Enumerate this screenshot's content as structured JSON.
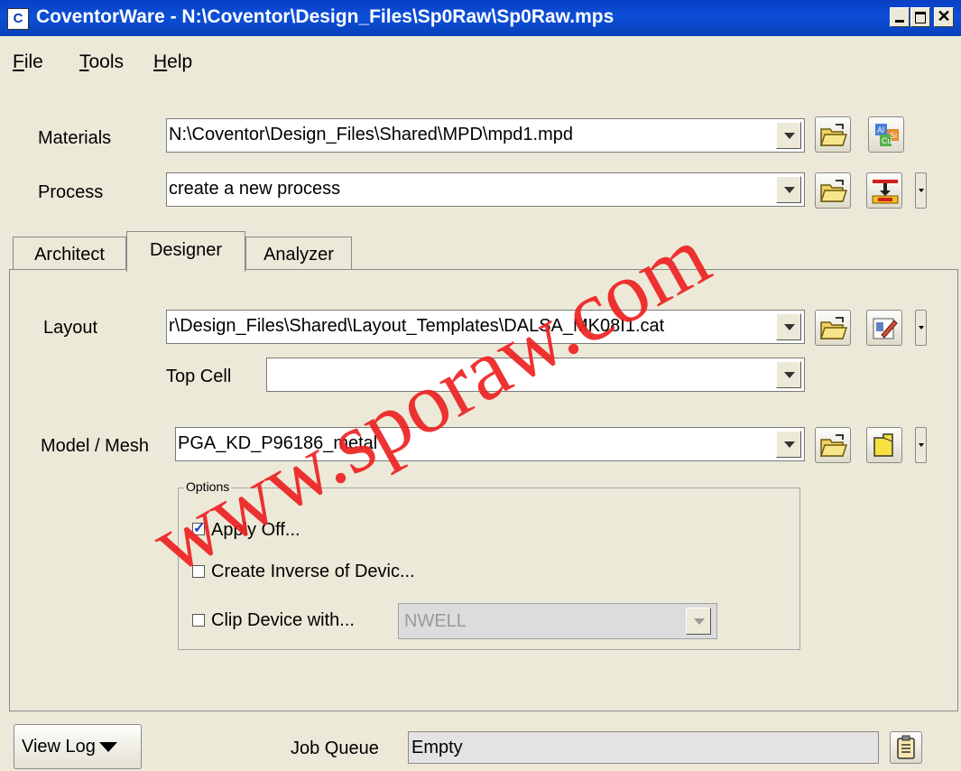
{
  "window": {
    "app_icon": "C",
    "title": "CoventorWare - N:\\Coventor\\Design_Files\\Sp0Raw\\Sp0Raw.mps",
    "close_glyph": "✕"
  },
  "menu": {
    "items": [
      {
        "first": "F",
        "rest": "ile"
      },
      {
        "first": "T",
        "rest": "ools"
      },
      {
        "first": "H",
        "rest": "elp"
      }
    ]
  },
  "materials": {
    "label": "Materials",
    "value": "N:\\Coventor\\Design_Files\\Shared\\MPD\\mpd1.mpd"
  },
  "process": {
    "label": "Process",
    "value": "create a new  process"
  },
  "tabs": [
    "Architect",
    "Designer",
    "Analyzer"
  ],
  "active_tab": "Designer",
  "designer": {
    "layout_label": "Layout",
    "layout_value": "r\\Design_Files\\Shared\\Layout_Templates\\DALSA_MK08I1.cat",
    "topcell_label": "Top Cell",
    "topcell_value": "",
    "model_label": "Model / Mesh",
    "model_value": "PGA_KD_P96186_metal",
    "options": {
      "legend": "Options",
      "apply_off": {
        "label": "Apply Off...",
        "checked": true
      },
      "create_inverse": {
        "label": "Create Inverse of Devic...",
        "checked": false
      },
      "clip_device": {
        "label": "Clip Device with...",
        "checked": false,
        "value": "NWELL"
      }
    }
  },
  "bottom": {
    "view_log_label": "View Log",
    "job_queue_label": "Job Queue",
    "job_queue_value": "Empty"
  },
  "watermark": "www.sporaw.com",
  "icons": {
    "open": "folder-open-icon",
    "materials": "materials-periodic-icon",
    "process": "process-editor-icon",
    "layout": "layout-editor-icon",
    "mesh": "mesh-icon",
    "job_queue": "clipboard-icon"
  }
}
